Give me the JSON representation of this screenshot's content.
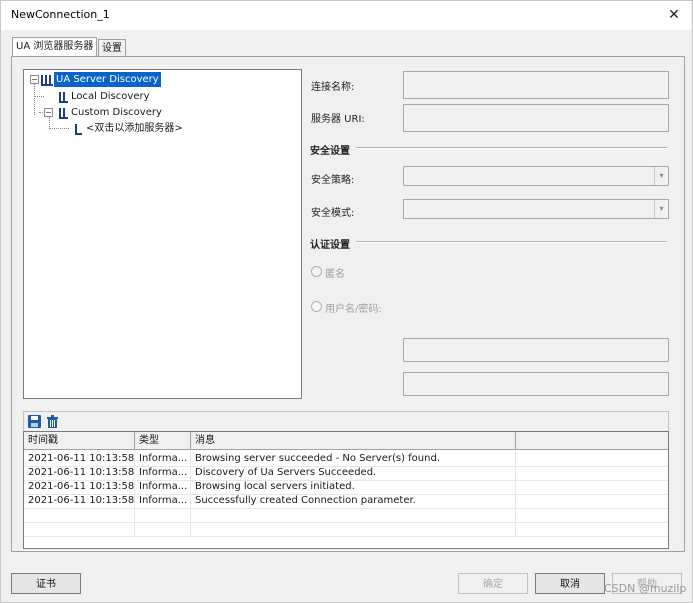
{
  "window": {
    "title": "NewConnection_1",
    "close_glyph": "✕"
  },
  "tabs": [
    {
      "label": "UA 浏览器服务器",
      "active": true
    },
    {
      "label": "设置",
      "active": false
    }
  ],
  "tree": {
    "root": "UA Server Discovery",
    "children": [
      {
        "label": "Local Discovery"
      },
      {
        "label": "Custom Discovery",
        "children": [
          {
            "label": "<双击以添加服务器>"
          }
        ]
      }
    ],
    "expander_glyph": "−"
  },
  "form": {
    "connection_name_label": "连接名称:",
    "server_uri_label": "服务器 URI:",
    "security_section": "安全设置",
    "security_policy_label": "安全策略:",
    "security_mode_label": "安全模式:",
    "auth_section": "认证设置",
    "anonymous_label": "匿名",
    "username_password_label": "用户名/密码:",
    "combo_arrow": "▾"
  },
  "log": {
    "columns": [
      "时间戳",
      "类型",
      "消息"
    ],
    "rows": [
      {
        "time": "2021-06-11 10:13:58...",
        "type": "Informa...",
        "message": "Browsing server succeeded - No Server(s) found."
      },
      {
        "time": "2021-06-11 10:13:58...",
        "type": "Informa...",
        "message": "Discovery of Ua Servers Succeeded."
      },
      {
        "time": "2021-06-11 10:13:58...",
        "type": "Informa...",
        "message": "Browsing local servers initiated."
      },
      {
        "time": "2021-06-11 10:13:58...",
        "type": "Informa...",
        "message": "Successfully created Connection parameter."
      }
    ]
  },
  "buttons": {
    "certificate": "证书",
    "ok": "确定",
    "cancel": "取消",
    "help": "帮助"
  },
  "watermark": "CSDN @muzilp",
  "colors": {
    "selection": "#0a64c8",
    "save_icon": "#1e5aa8"
  }
}
